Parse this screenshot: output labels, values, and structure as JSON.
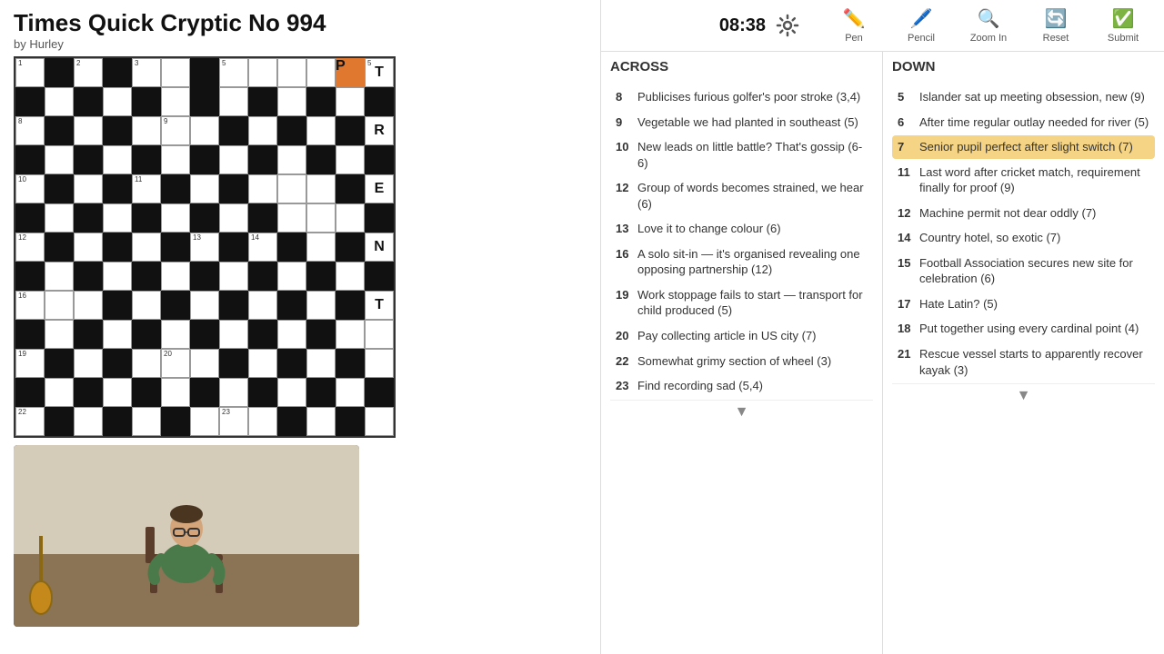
{
  "title": "Times Quick Cryptic No 994",
  "byline": "by Hurley",
  "timer": "08:38",
  "toolbar": {
    "pen": "Pen",
    "pencil": "Pencil",
    "zoom_in": "Zoom In",
    "reset": "Reset",
    "submit": "Submit"
  },
  "across_header": "ACROSS",
  "down_header": "DOWN",
  "clues": {
    "across": [
      {
        "num": "8",
        "text": "Publicises furious golfer's poor stroke (3,4)"
      },
      {
        "num": "9",
        "text": "Vegetable we had planted in southeast (5)"
      },
      {
        "num": "10",
        "text": "New leads on little battle? That's gossip (6-6)"
      },
      {
        "num": "12",
        "text": "Group of words becomes strained, we hear (6)"
      },
      {
        "num": "13",
        "text": "Love it to change colour (6)"
      },
      {
        "num": "16",
        "text": "A solo sit-in — it's organised revealing one opposing partnership (12)"
      },
      {
        "num": "19",
        "text": "Work stoppage fails to start — transport for child produced (5)"
      },
      {
        "num": "20",
        "text": "Pay collecting article in US city (7)"
      },
      {
        "num": "22",
        "text": "Somewhat grimy section of wheel (3)"
      },
      {
        "num": "23",
        "text": "Find recording sad (5,4)"
      }
    ],
    "down": [
      {
        "num": "5",
        "text": "Islander sat up meeting obsession, new (9)"
      },
      {
        "num": "6",
        "text": "After time regular outlay needed for river (5)"
      },
      {
        "num": "7",
        "text": "Senior pupil perfect after slight switch (7)",
        "active": true
      },
      {
        "num": "11",
        "text": "Last word after cricket match, requirement finally for proof (9)"
      },
      {
        "num": "12",
        "text": "Machine permit not dear oddly (7)"
      },
      {
        "num": "14",
        "text": "Country hotel, so exotic (7)"
      },
      {
        "num": "15",
        "text": "Football Association secures new site for celebration (6)"
      },
      {
        "num": "17",
        "text": "Hate Latin? (5)"
      },
      {
        "num": "18",
        "text": "Put together using every cardinal point (4)"
      },
      {
        "num": "21",
        "text": "Rescue vessel starts to apparently recover kayak (3)"
      }
    ]
  },
  "grid": {
    "rows": 13,
    "cols": 13
  }
}
